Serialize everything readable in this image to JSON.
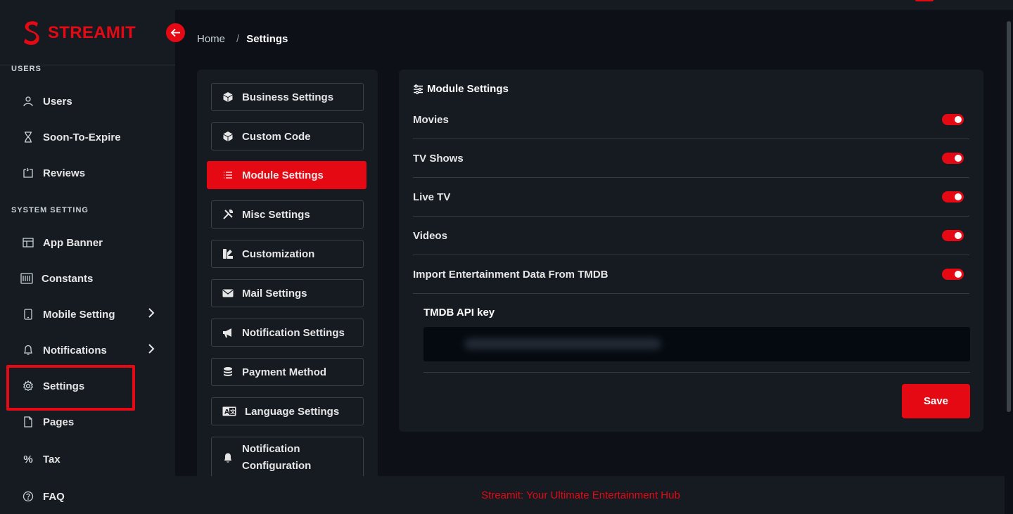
{
  "brand": {
    "name": "STREAMIT",
    "color": "#e50914"
  },
  "sidebar": {
    "sections": [
      {
        "label": "USERS"
      },
      {
        "label": "SYSTEM SETTING"
      }
    ],
    "items": [
      {
        "label": "Users",
        "icon": "user-icon"
      },
      {
        "label": "Soon-To-Expire",
        "icon": "hourglass-icon"
      },
      {
        "label": "Reviews",
        "icon": "review-icon"
      },
      {
        "label": "App Banner",
        "icon": "layout-icon"
      },
      {
        "label": "Constants",
        "icon": "constants-icon"
      },
      {
        "label": "Mobile Setting",
        "icon": "mobile-icon"
      },
      {
        "label": "Notifications",
        "icon": "bell-icon"
      },
      {
        "label": "Settings",
        "icon": "gear-icon"
      },
      {
        "label": "Pages",
        "icon": "page-icon"
      },
      {
        "label": "Tax",
        "icon": "percent-icon"
      },
      {
        "label": "FAQ",
        "icon": "question-icon"
      }
    ]
  },
  "breadcrumb": {
    "home": "Home",
    "separator": "/",
    "current": "Settings"
  },
  "settings_nav": {
    "items": [
      {
        "label": "Business Settings",
        "icon": "cube-icon"
      },
      {
        "label": "Custom Code",
        "icon": "cube-icon"
      },
      {
        "label": "Module Settings",
        "icon": "list-icon",
        "active": true
      },
      {
        "label": "Misc Settings",
        "icon": "tools-icon"
      },
      {
        "label": "Customization",
        "icon": "brush-icon"
      },
      {
        "label": "Mail Settings",
        "icon": "envelope-icon"
      },
      {
        "label": "Notification Settings",
        "icon": "megaphone-icon"
      },
      {
        "label": "Payment Method",
        "icon": "coins-icon"
      },
      {
        "label": "Language Settings",
        "icon": "language-icon"
      },
      {
        "label": "Notification Configuration",
        "line1": "Notification",
        "line2": "Configuration",
        "icon": "bell-icon"
      }
    ]
  },
  "module_settings": {
    "title": "Module Settings",
    "rows": [
      {
        "label": "Movies",
        "enabled": true
      },
      {
        "label": "TV Shows",
        "enabled": true
      },
      {
        "label": "Live TV",
        "enabled": true
      },
      {
        "label": "Videos",
        "enabled": true
      },
      {
        "label": "Import Entertainment Data From TMDB",
        "enabled": true
      }
    ],
    "api_key_label": "TMDB API key",
    "save_label": "Save"
  },
  "footer": {
    "text": "Streamit: Your Ultimate Entertainment Hub"
  }
}
